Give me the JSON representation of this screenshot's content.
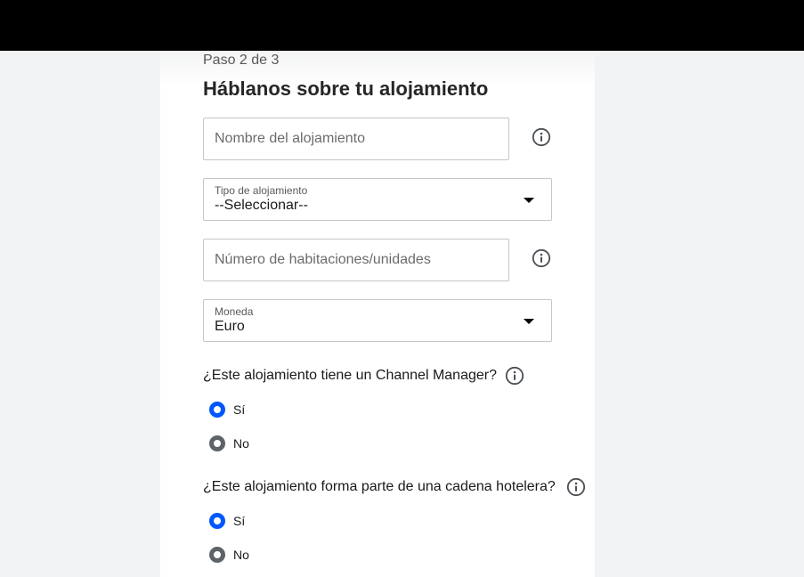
{
  "form": {
    "step": "Paso 2 de 3",
    "title": "Háblanos sobre tu alojamiento",
    "property_name": {
      "placeholder": "Nombre del alojamiento",
      "value": ""
    },
    "property_type": {
      "label": "Tipo de alojamiento",
      "value": "--Seleccionar--"
    },
    "rooms": {
      "placeholder": "Número de habitaciones/unidades",
      "value": ""
    },
    "currency": {
      "label": "Moneda",
      "value": "Euro"
    },
    "channel_manager": {
      "question": "¿Este alojamiento tiene un Channel Manager?",
      "options": [
        {
          "label": "Sí",
          "selected": true
        },
        {
          "label": "No",
          "selected": false
        }
      ]
    },
    "hotel_chain": {
      "question": "¿Este alojamiento forma parte de una cadena hotelera?",
      "options": [
        {
          "label": "Sí",
          "selected": true
        },
        {
          "label": "No",
          "selected": false
        }
      ]
    }
  },
  "icons": {
    "info": "info-circle-icon",
    "dropdown": "caret-down-icon"
  },
  "colors": {
    "radio_selected": "#0057ff",
    "radio_unselected": "#5d6469",
    "topbar": "#000000"
  }
}
